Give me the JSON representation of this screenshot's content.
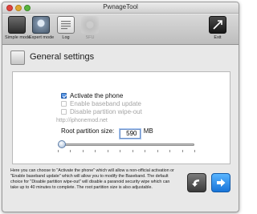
{
  "window": {
    "title": "PwnageTool"
  },
  "toolbar": {
    "items": [
      {
        "label": "Simple mode",
        "icon": "simple-mode-icon"
      },
      {
        "label": "Expert mode",
        "icon": "expert-mode-icon"
      },
      {
        "label": "Log",
        "icon": "log-icon"
      },
      {
        "label": "SFU",
        "icon": "sfu-icon"
      },
      {
        "label": "Exit",
        "icon": "exit-icon"
      }
    ]
  },
  "header": {
    "title": "General settings",
    "icon": "settings-page-icon"
  },
  "settings": {
    "options": [
      {
        "label": "Activate the phone",
        "checked": true,
        "enabled": true
      },
      {
        "label": "Enable baseband update",
        "checked": false,
        "enabled": false
      },
      {
        "label": "Disable partition wipe-out",
        "checked": false,
        "enabled": false
      }
    ],
    "watermark": "http://iphonemod.net",
    "partition_label": "Root partition size:",
    "partition_value": "590",
    "partition_unit": "MB",
    "slider_fraction": 0.03
  },
  "help_text": "Here you can choose to \"Activate the phone\" which will allow a non-official activation or \"Enable baseband update\" which will allow you to modify the Baseband. The default choice for \"Disable partition wipe-out\" will disable a paranoid security wipe which can take up to 40 minutes to complete. The root partition size is also adjustable.",
  "nav": {
    "back_icon": "back-arrow-icon",
    "next_icon": "next-arrow-icon"
  },
  "colors": {
    "accent": "#1874d8",
    "checkbox": "#2c6ccd"
  }
}
